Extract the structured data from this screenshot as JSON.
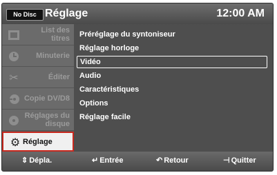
{
  "header": {
    "badge": "No Disc",
    "title": "Réglage",
    "clock": "12:00 AM"
  },
  "sidebar": {
    "items": [
      {
        "label": "List des titres",
        "icon": "title-list-icon"
      },
      {
        "label": "Minuterie",
        "icon": "timer-icon"
      },
      {
        "label": "Éditer",
        "icon": "scissors-icon"
      },
      {
        "label": "Copie DV/D8",
        "icon": "copy-disc-icon"
      },
      {
        "label": "Réglages du disque",
        "icon": "disc-settings-icon"
      },
      {
        "label": "Réglage",
        "icon": "gear-icon",
        "active": true
      }
    ]
  },
  "menu": {
    "items": [
      "Préréglage du syntoniseur",
      "Réglage horloge",
      "Vidéo",
      "Audio",
      "Caractéristiques",
      "Options",
      "Réglage facile"
    ],
    "selected_index": 2
  },
  "footer": {
    "move": "Dépla.",
    "enter": "Entrée",
    "back": "Retour",
    "quit": "Quitter"
  }
}
